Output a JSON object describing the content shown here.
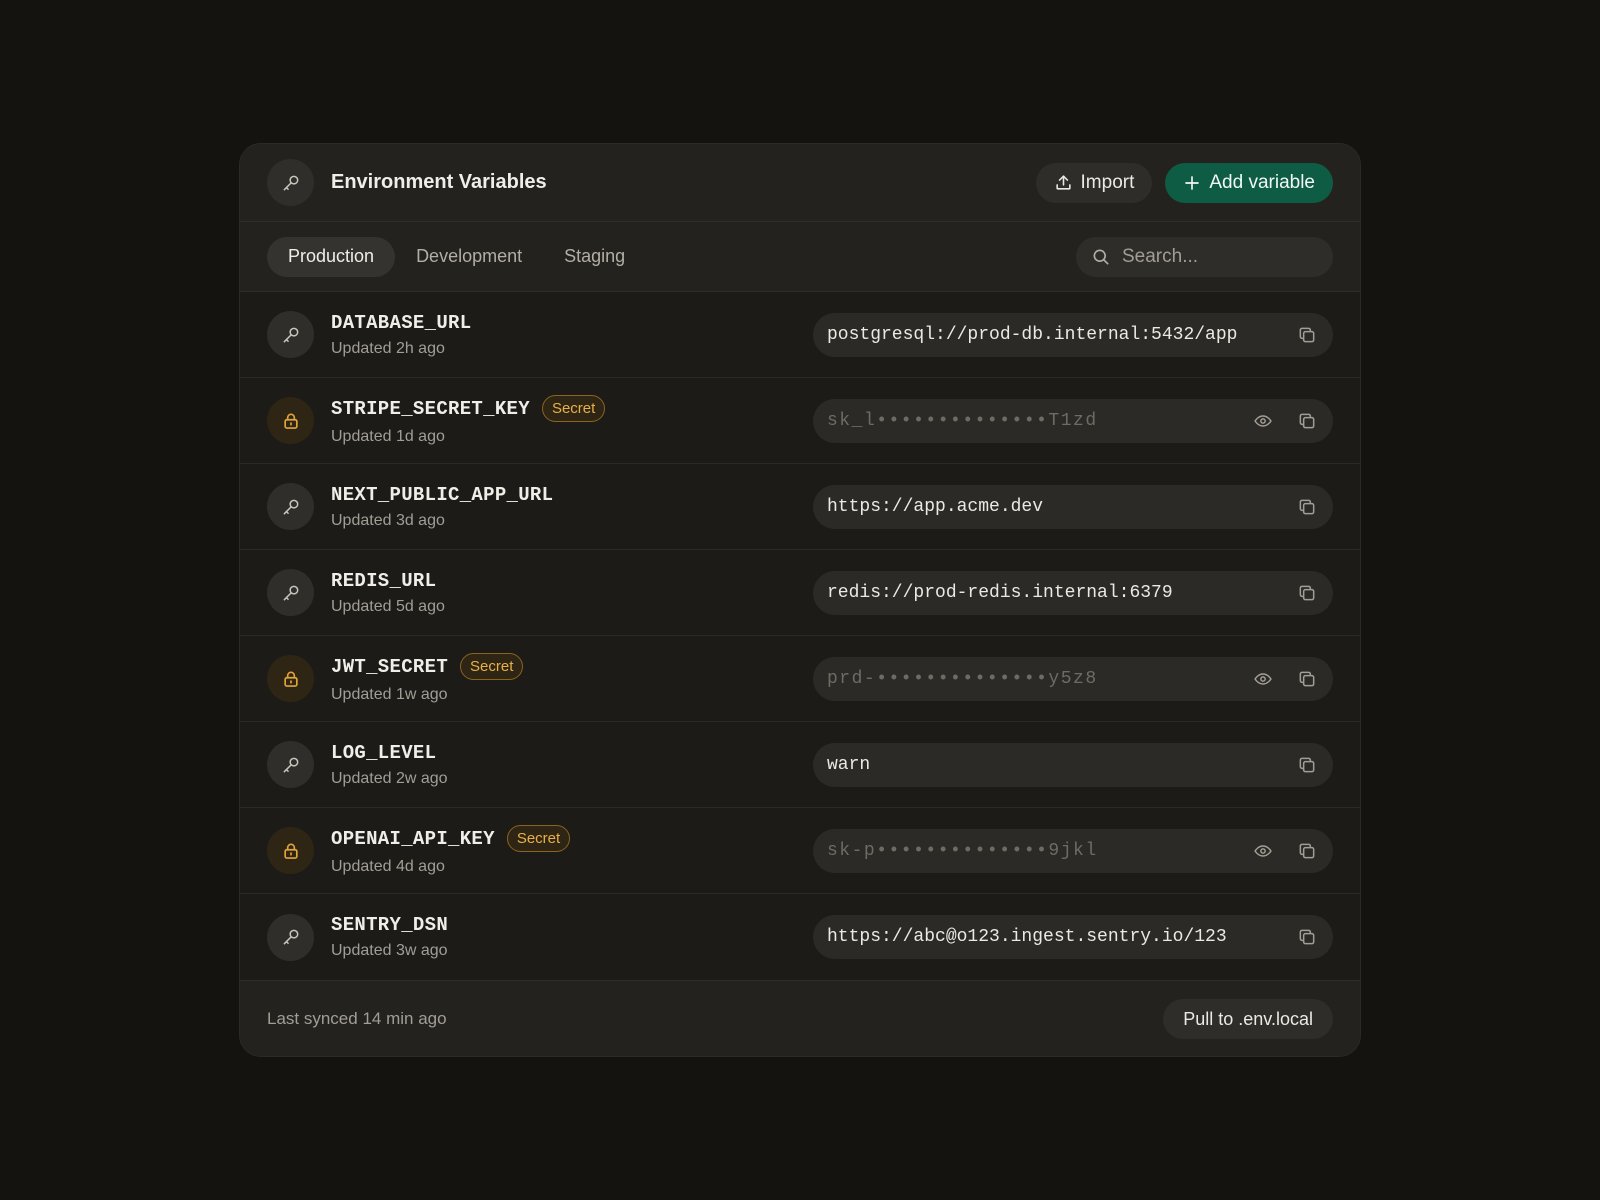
{
  "header": {
    "title": "Environment Variables",
    "import_label": "Import",
    "add_label": "Add variable"
  },
  "tabs": [
    {
      "label": "Production",
      "active": true
    },
    {
      "label": "Development",
      "active": false
    },
    {
      "label": "Staging",
      "active": false
    }
  ],
  "search": {
    "placeholder": "Search..."
  },
  "variables": [
    {
      "name": "DATABASE_URL",
      "updated": "Updated 2h ago",
      "secret": false,
      "value": "postgresql://prod-db.internal:5432/app"
    },
    {
      "name": "STRIPE_SECRET_KEY",
      "badge": "Secret",
      "updated": "Updated 1d ago",
      "secret": true,
      "value": "sk_l••••••••••••••T1zd"
    },
    {
      "name": "NEXT_PUBLIC_APP_URL",
      "updated": "Updated 3d ago",
      "secret": false,
      "value": "https://app.acme.dev"
    },
    {
      "name": "REDIS_URL",
      "updated": "Updated 5d ago",
      "secret": false,
      "value": "redis://prod-redis.internal:6379"
    },
    {
      "name": "JWT_SECRET",
      "badge": "Secret",
      "updated": "Updated 1w ago",
      "secret": true,
      "value": "prd-••••••••••••••y5z8"
    },
    {
      "name": "LOG_LEVEL",
      "updated": "Updated 2w ago",
      "secret": false,
      "value": "warn"
    },
    {
      "name": "OPENAI_API_KEY",
      "badge": "Secret",
      "updated": "Updated 4d ago",
      "secret": true,
      "value": "sk-p••••••••••••••9jkl"
    },
    {
      "name": "SENTRY_DSN",
      "updated": "Updated 3w ago",
      "secret": false,
      "value": "https://abc@o123.ingest.sentry.io/123"
    }
  ],
  "footer": {
    "sync_text": "Last synced 14 min ago",
    "pull_label": "Pull to .env.local"
  },
  "colors": {
    "accent": "#0e5c44",
    "secret": "#e0a43b",
    "background": "#141310",
    "panel": "#1c1b18"
  },
  "icons": {
    "header": "key-icon",
    "import": "upload-icon",
    "add": "plus-icon",
    "search": "search-icon",
    "variable": "key-icon",
    "secret_variable": "lock-icon",
    "reveal": "eye-icon",
    "copy": "copy-icon"
  }
}
